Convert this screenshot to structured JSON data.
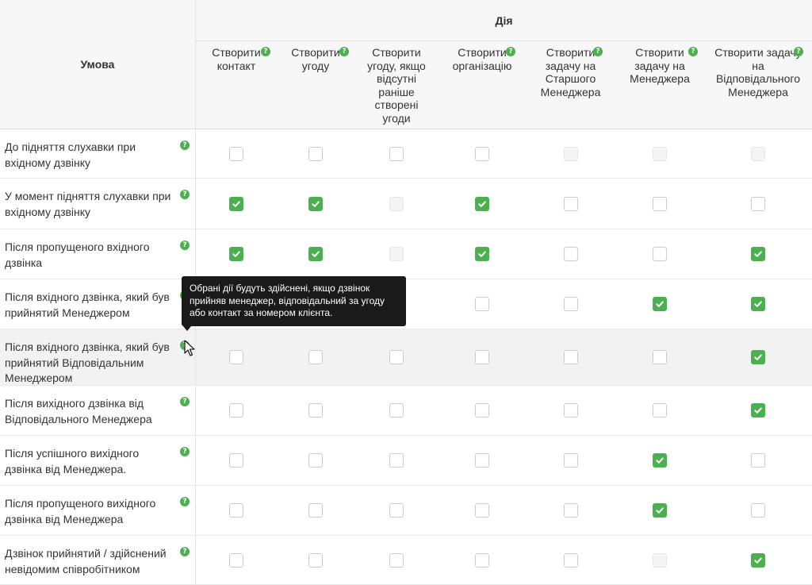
{
  "header": {
    "condition_label": "Умова",
    "action_label": "Дія"
  },
  "actions": [
    {
      "label": "Створити\nконтакт",
      "help": "?"
    },
    {
      "label": "Створити\nугоду",
      "help": "?"
    },
    {
      "label": "Створити\nугоду, якщо\nвідсутні\nраніше\nстворені\nугоди",
      "help": "?"
    },
    {
      "label": "Створити\nорганізацію",
      "help": "?"
    },
    {
      "label": "Створити\nзадачу на\nСтаршого\nМенеджера",
      "help": "?"
    },
    {
      "label": "Створити\nзадачу на\nМенеджера",
      "help": "?"
    },
    {
      "label": "Створити задачу\nна\nВідповідального\nМенеджера",
      "help": "?"
    }
  ],
  "rows": [
    {
      "condition": "До підняття слухавки при вхідному дзвінку",
      "help": "?",
      "states": [
        "unchecked",
        "unchecked",
        "unchecked",
        "unchecked",
        "disabled",
        "disabled",
        "disabled"
      ]
    },
    {
      "condition": "У момент підняття слухавки при вхідному дзвінку",
      "help": "?",
      "states": [
        "checked",
        "checked",
        "disabled",
        "checked",
        "unchecked",
        "unchecked",
        "unchecked"
      ]
    },
    {
      "condition": "Після пропущеного вхідного дзвінка",
      "help": "?",
      "states": [
        "checked",
        "checked",
        "disabled",
        "checked",
        "unchecked",
        "unchecked",
        "checked"
      ]
    },
    {
      "condition": "Після вхідного дзвінка, який був прийнятий Менеджером",
      "help": "?",
      "states": [
        "unchecked",
        "unchecked",
        "unchecked",
        "unchecked",
        "unchecked",
        "checked",
        "checked"
      ]
    },
    {
      "condition": "Після вхідного дзвінка, який був прийнятий Відповідальним Менеджером",
      "help": "?",
      "states": [
        "unchecked",
        "unchecked",
        "unchecked",
        "unchecked",
        "unchecked",
        "unchecked",
        "checked"
      ]
    },
    {
      "condition": "Після вихідного дзвінка від Відповідального Менеджера",
      "help": "?",
      "states": [
        "unchecked",
        "unchecked",
        "unchecked",
        "unchecked",
        "unchecked",
        "unchecked",
        "checked"
      ]
    },
    {
      "condition": "Після успішного вихідного дзвінка від Менеджера.",
      "help": "?",
      "states": [
        "unchecked",
        "unchecked",
        "unchecked",
        "unchecked",
        "unchecked",
        "checked",
        "unchecked"
      ]
    },
    {
      "condition": "Після пропущеного вихідного дзвінка від Менеджера",
      "help": "?",
      "states": [
        "unchecked",
        "unchecked",
        "unchecked",
        "unchecked",
        "unchecked",
        "checked",
        "unchecked"
      ]
    },
    {
      "condition": "Дзвінок прийнятий / здійснений невідомим співробітником",
      "help": "?",
      "states": [
        "unchecked",
        "unchecked",
        "unchecked",
        "unchecked",
        "unchecked",
        "disabled",
        "checked"
      ]
    }
  ],
  "highlighted_row": 4,
  "tooltip": {
    "text": "Обрані дії будуть здійснені, якщо дзвінок прийняв менеджер, відповідальний за угоду або контакт за номером клієнта."
  },
  "colors": {
    "accent": "#4caf50",
    "tooltip_bg": "#1a1a1a",
    "header_bg": "#f7f7f7",
    "row_highlight": "#f2f2f2"
  }
}
